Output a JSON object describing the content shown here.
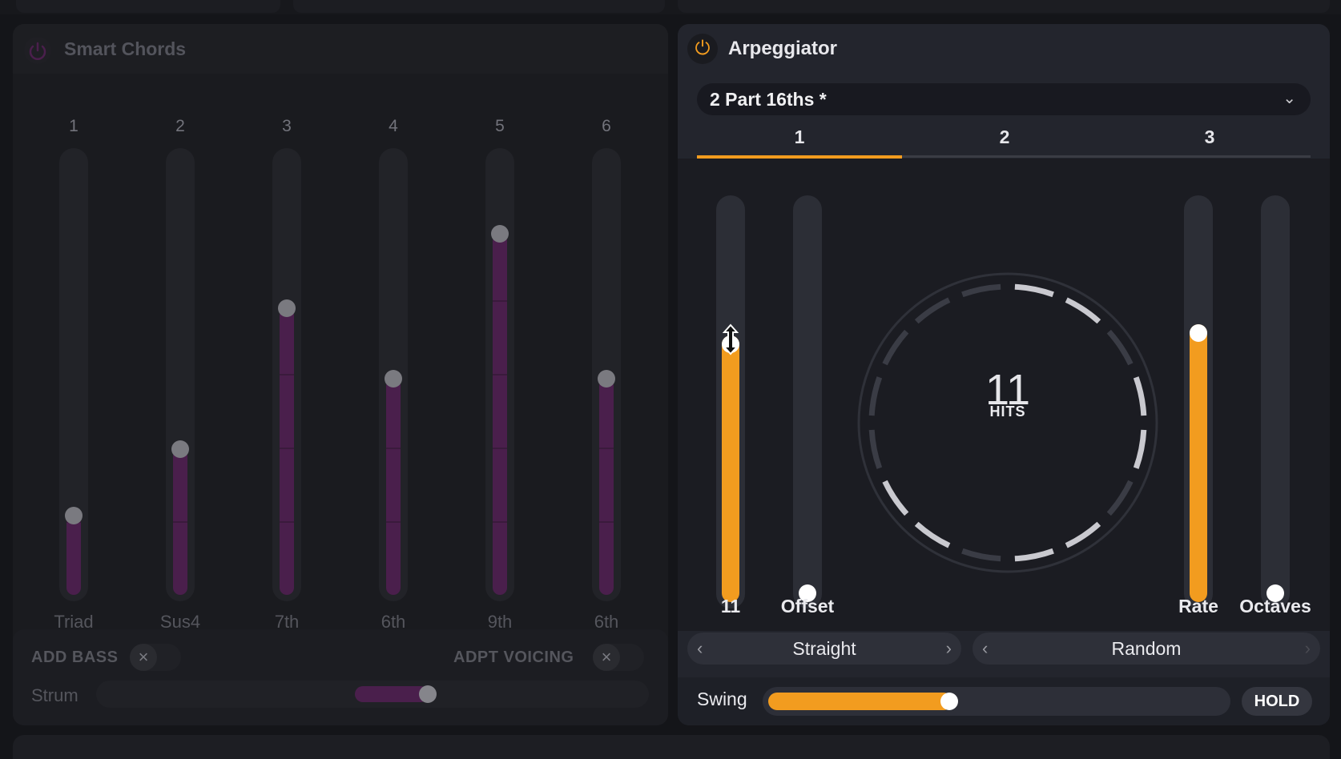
{
  "colors": {
    "accent": "#f29c1f",
    "chord_purple": "#4a1f4c"
  },
  "smart_chords": {
    "title": "Smart Chords",
    "slots": [
      {
        "num": "1",
        "label": "Triad",
        "level": 0.18
      },
      {
        "num": "2",
        "label": "Sus4",
        "level": 0.33
      },
      {
        "num": "3",
        "label": "7th",
        "level": 0.65
      },
      {
        "num": "4",
        "label": "6th",
        "level": 0.49
      },
      {
        "num": "5",
        "label": "9th",
        "level": 0.82
      },
      {
        "num": "6",
        "label": "6th",
        "level": 0.49
      }
    ],
    "add_bass": "ADD BASS",
    "adpt_voicing": "ADPT VOICING",
    "toggle_icon": "×",
    "strum_label": "Strum",
    "strum_level": 0.6
  },
  "arpeggiator": {
    "title": "Arpeggiator",
    "power_icon": "⏻",
    "preset": "2 Part 16ths *",
    "chevron": "⌄",
    "tabs": [
      "1",
      "2",
      "3"
    ],
    "hits_value": "11",
    "hits_slider_level": 0.65,
    "hits_label": "HITS",
    "offset_label": "Offset",
    "offset_level": 0.0,
    "rate_label": "Rate",
    "rate_level": 0.68,
    "octaves_label": "Octaves",
    "octaves_level": 0.0,
    "left_selector": "Straight",
    "right_selector": "Random",
    "arrow_left": "‹",
    "arrow_right": "›",
    "swing_label": "Swing",
    "swing_level": 0.38,
    "hold_label": "HOLD"
  }
}
